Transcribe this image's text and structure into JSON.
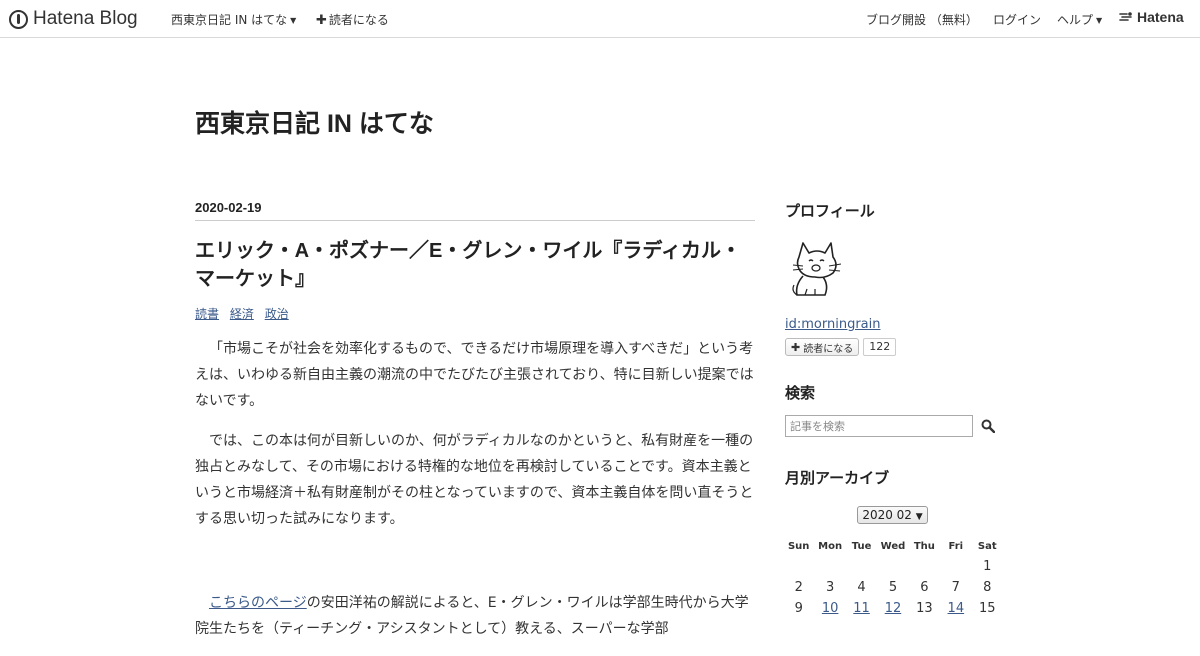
{
  "header": {
    "logo_text": "Hatena Blog",
    "blog_name": "西東京日記 IN はてな",
    "subscribe_label": "読者になる",
    "open_blog_label": "ブログ開設 （無料）",
    "login_label": "ログイン",
    "help_label": "ヘルプ",
    "hatena_label": "Hatena"
  },
  "blog": {
    "title": "西東京日記 IN はてな"
  },
  "entry": {
    "date": "2020-02-19",
    "title": "エリック・A・ポズナー／E・グレン・ワイル『ラディカル・マーケット』",
    "categories": [
      "読書",
      "経済",
      "政治"
    ],
    "paragraphs": {
      "p1": "「市場こそが社会を効率化するもので、できるだけ市場原理を導入すべきだ」という考えは、いわゆる新自由主義の潮流の中でたびたび主張されており、特に目新しい提案ではないです。",
      "p2": "では、この本は何が目新しいのか、何がラディカルなのかというと、私有財産を一種の独占とみなして、その市場における特権的な地位を再検討していることです。資本主義というと市場経済＋私有財産制がその柱となっていますので、資本主義自体を問い直そうとする思い切った試みになります。",
      "p3_link": "こちらのページ",
      "p3_rest": "の安田洋祐の解説によると、E・グレン・ワイルは学部生時代から大学院生たちを（ティーチング・アシスタントとして）教える、スーパーな学部"
    }
  },
  "sidebar": {
    "profile_title": "プロフィール",
    "profile_id": "id:morningrain",
    "subscribe_label": "読者になる",
    "subscriber_count": "122",
    "search_title": "検索",
    "search_placeholder": "記事を検索",
    "archive_title": "月別アーカイブ",
    "archive_selected": "2020 02",
    "calendar": {
      "weekdays": [
        "Sun",
        "Mon",
        "Tue",
        "Wed",
        "Thu",
        "Fri",
        "Sat"
      ],
      "rows": [
        [
          {
            "d": "",
            "link": false
          },
          {
            "d": "",
            "link": false
          },
          {
            "d": "",
            "link": false
          },
          {
            "d": "",
            "link": false
          },
          {
            "d": "",
            "link": false
          },
          {
            "d": "",
            "link": false
          },
          {
            "d": "1",
            "link": false
          }
        ],
        [
          {
            "d": "2",
            "link": false
          },
          {
            "d": "3",
            "link": false
          },
          {
            "d": "4",
            "link": false
          },
          {
            "d": "5",
            "link": false
          },
          {
            "d": "6",
            "link": false
          },
          {
            "d": "7",
            "link": false
          },
          {
            "d": "8",
            "link": false
          }
        ],
        [
          {
            "d": "9",
            "link": false
          },
          {
            "d": "10",
            "link": true
          },
          {
            "d": "11",
            "link": true
          },
          {
            "d": "12",
            "link": true
          },
          {
            "d": "13",
            "link": false
          },
          {
            "d": "14",
            "link": true
          },
          {
            "d": "15",
            "link": false
          }
        ]
      ]
    }
  }
}
